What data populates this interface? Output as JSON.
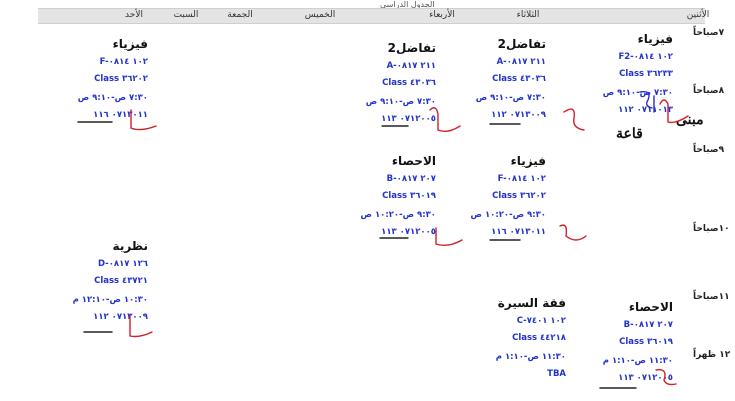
{
  "header": {
    "top_text": "الجدول الدراسي",
    "days": [
      "الأثنين",
      "الثلاثاء",
      "الأربعاء",
      "الخميس",
      "الجمعة",
      "السبت",
      "الأحد"
    ]
  },
  "times": [
    "٧صباحاً",
    "٨صباحاً",
    "٩صباحاً",
    "١٠صباحاً",
    "١١صباحاً",
    "١٢ ظهراً"
  ],
  "classes": [
    {
      "title": "فيزياء",
      "section": "F2-١٠٢ ٠٨١٤",
      "class_line": "Class ٣٦٢٣٣",
      "time": "٧:٣٠ ص-٩:١٠ ص",
      "room": "٠٧١١٠١٣ ١١٢"
    },
    {
      "title": "تفاضل2",
      "section": "A-٢١١ ٠٨١٧",
      "class_line": "Class ٤٣٠٣٦",
      "time": "٧:٣٠ ص-٩:١٠ ص",
      "room": "٠٧١٣٠٠٩ ١١٢"
    },
    {
      "title": "تفاضل2",
      "section": "A-٢١١ ٠٨١٧",
      "class_line": "Class ٤٣٠٣٦",
      "time": "٧:٣٠ ص-٩:١٠ ص",
      "room": "٠٧١٢٠٠٥ ١١٣"
    },
    {
      "title": "فيزياء",
      "section": "F-١٠٢ ٠٨١٤",
      "class_line": "Class ٣٦٢٠٢",
      "time": "٧:٣٠ ص-٩:١٠ ص",
      "room": "٠٧١٣٠١١ ١١٦"
    },
    {
      "title": "فيزياء",
      "section": "F-١٠٢ ٠٨١٤",
      "class_line": "Class ٣٦٢٠٢",
      "time": "٩:٣٠ ص-١٠:٢٠ ص",
      "room": "٠٧١٣٠١١ ١١٦"
    },
    {
      "title": "الاحصاء",
      "section": "B-٢٠٧ ٠٨١٧",
      "class_line": "Class ٣٦٠١٩",
      "time": "٩:٣٠ ص-١٠:٢٠ ص",
      "room": "٠٧١٢٠٠٥ ١١٣"
    },
    {
      "title": "نظرية",
      "section": "D-١٢٦ ٠٨١٧",
      "class_line": "Class ٤٣٧٢١",
      "time": "١٠:٣٠ ص-١٢:١٠ م",
      "room": "٠٧١٣٠٠٩ ١١٢"
    },
    {
      "title": "الاحصاء",
      "section": "B-٢٠٧ ٠٨١٧",
      "class_line": "Class ٣٦٠١٩",
      "time": "١١:٣٠ ص-١:١٠ م",
      "room": "٠٧١٢٠٠٥ ١١٣"
    },
    {
      "title": "فقة السيرة",
      "section": "C-١٠٢ ٧٤٠١",
      "class_line": "Class ٤٤٢١٨",
      "time": "١١:٣٠ ص-١:١٠ م",
      "room": "TBA"
    }
  ],
  "annotations": {
    "note1": "مبنى",
    "note2": "قاعة"
  }
}
